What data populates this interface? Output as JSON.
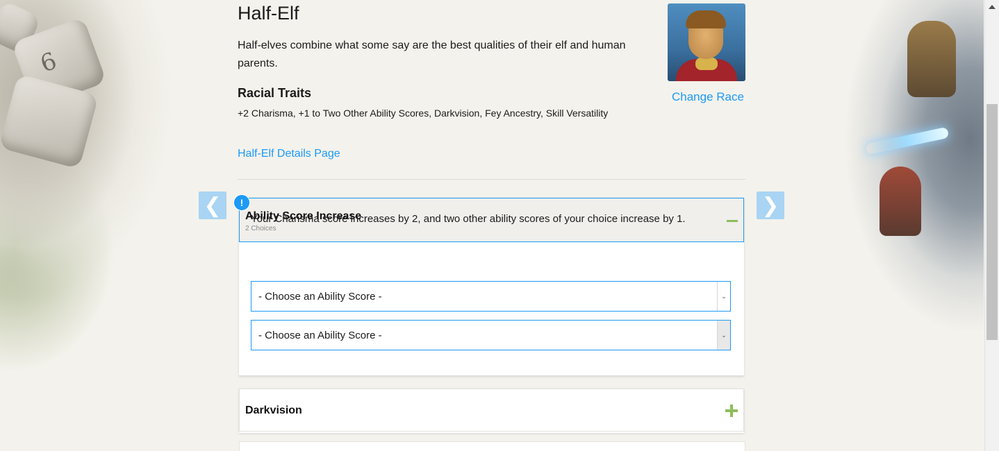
{
  "race": {
    "name": "Half-Elf",
    "description": "Half-elves combine what some say are the best qualities of their elf and human parents.",
    "traits_heading": "Racial Traits",
    "traits": "+2 Charisma, +1 to Two Other Ability Scores, Darkvision, Fey Ancestry, Skill Versatility",
    "details_link": "Half-Elf Details Page",
    "change_race": "Change Race"
  },
  "nav": {
    "prev_icon": "chevron-left-icon",
    "next_icon": "chevron-right-icon",
    "prev_glyph": "❮",
    "next_glyph": "❯"
  },
  "ability_panel": {
    "badge": "!",
    "title": "Ability Score Increase",
    "subtitle": "2 Choices",
    "description": "Your Charisma score increases by 2, and two other ability scores of your choice increase by 1.",
    "selects": [
      {
        "value": "- Choose an Ability Score -"
      },
      {
        "value": "- Choose an Ability Score -"
      }
    ],
    "select_arrow": "⌄"
  },
  "darkvision_panel": {
    "title": "Darkvision"
  },
  "colors": {
    "accent": "#1b9af7",
    "toggle_green": "#8dbd5b",
    "nav_arrow_bg": "#a9d4f3",
    "panel_header_bg": "#f0efec"
  }
}
